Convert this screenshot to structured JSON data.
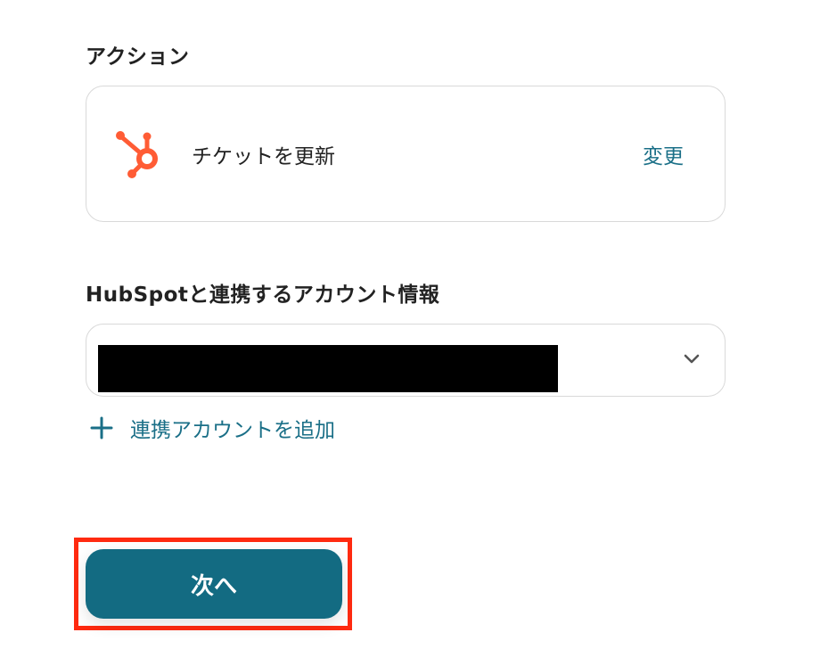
{
  "action_section": {
    "title": "アクション",
    "app_icon": "hubspot-icon",
    "action_name": "チケットを更新",
    "change_label": "変更"
  },
  "account_section": {
    "title": "HubSpotと連携するアカウント情報",
    "selected_value": "",
    "dropdown_icon": "chevron-down-icon",
    "add_account_label": "連携アカウントを追加",
    "add_icon": "plus-icon"
  },
  "footer": {
    "next_label": "次へ"
  },
  "colors": {
    "accent": "#1a6f87",
    "button": "#136b82",
    "hubspot": "#ff5c35",
    "highlight": "#ff2a10",
    "border": "#d9d9d9"
  }
}
